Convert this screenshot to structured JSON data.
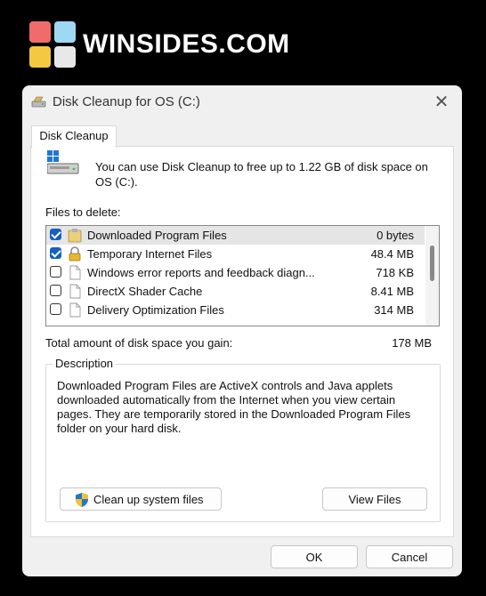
{
  "brand": {
    "name": "WINSIDES.COM"
  },
  "window": {
    "title": "Disk Cleanup for OS (C:)",
    "close_icon": "close-icon"
  },
  "tab": {
    "label": "Disk Cleanup"
  },
  "info": {
    "text": "You can use Disk Cleanup to free up to 1.22 GB of disk space on OS (C:)."
  },
  "files_label": "Files to delete:",
  "files": [
    {
      "name": "Downloaded Program Files",
      "size": "0 bytes",
      "checked": true,
      "icon": "folder-icon",
      "selected": true
    },
    {
      "name": "Temporary Internet Files",
      "size": "48.4 MB",
      "checked": true,
      "icon": "lock-icon",
      "selected": false
    },
    {
      "name": "Windows error reports and feedback diagn...",
      "size": "718 KB",
      "checked": false,
      "icon": "document-icon",
      "selected": false
    },
    {
      "name": "DirectX Shader Cache",
      "size": "8.41 MB",
      "checked": false,
      "icon": "document-icon",
      "selected": false
    },
    {
      "name": "Delivery Optimization Files",
      "size": "314 MB",
      "checked": false,
      "icon": "document-icon",
      "selected": false
    }
  ],
  "total": {
    "label": "Total amount of disk space you gain:",
    "value": "178 MB"
  },
  "description": {
    "title": "Description",
    "text": "Downloaded Program Files are ActiveX controls and Java applets downloaded automatically from the Internet when you view certain pages. They are temporarily stored in the Downloaded Program Files folder on your hard disk."
  },
  "buttons": {
    "cleanup": "Clean up system files",
    "view_files": "View Files",
    "ok": "OK",
    "cancel": "Cancel"
  },
  "colors": {
    "accent": "#1560c0",
    "window_bg": "#f0f0f0"
  }
}
